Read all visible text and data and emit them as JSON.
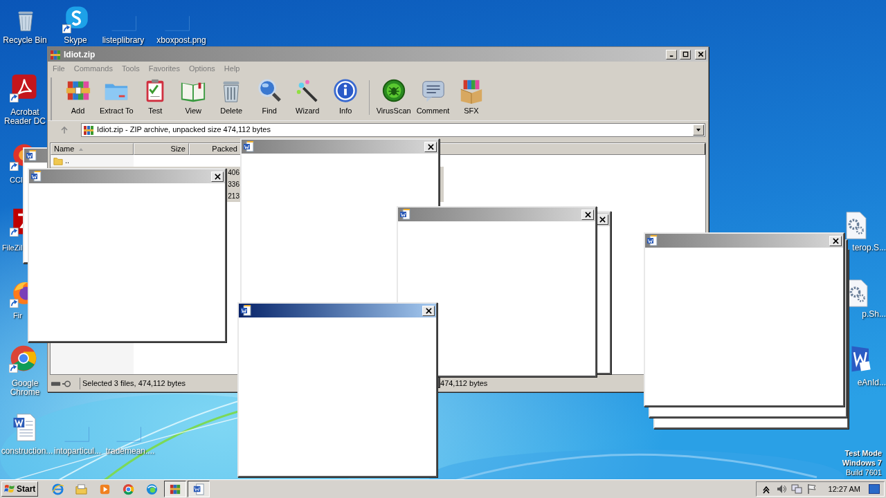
{
  "desktop_icons": [
    {
      "label": "Recycle Bin",
      "kind": "bin",
      "shortcut": false
    },
    {
      "label": "Skype",
      "kind": "skype",
      "shortcut": true
    },
    {
      "label": "listeplibrary",
      "kind": "blank",
      "shortcut": false
    },
    {
      "label": "xboxpost.png",
      "kind": "blank",
      "shortcut": false
    },
    {
      "label": "Acrobat Reader DC",
      "kind": "acrobat",
      "shortcut": true
    },
    {
      "label": "CCl",
      "kind": "ccleaner",
      "shortcut": true
    },
    {
      "label": "FileZil",
      "kind": "filezilla",
      "shortcut": true
    },
    {
      "label": "Fir",
      "kind": "firefox",
      "shortcut": true
    },
    {
      "label": "Google Chrome",
      "kind": "chrome",
      "shortcut": true
    },
    {
      "label": "construction...",
      "kind": "worddoc",
      "shortcut": false
    },
    {
      "label": "intoparticul...",
      "kind": "blank",
      "shortcut": false
    },
    {
      "label": "trademean....",
      "kind": "blank",
      "shortcut": false
    },
    {
      "label": "terop.S...",
      "kind": "gear",
      "shortcut": false
    },
    {
      "label": "p.Sh...",
      "kind": "gear",
      "shortcut": false
    },
    {
      "label": "eAnId...",
      "kind": "word",
      "shortcut": false
    }
  ],
  "winrar": {
    "title": "Idiot.zip",
    "active": false,
    "menu": [
      "File",
      "Commands",
      "Tools",
      "Favorites",
      "Options",
      "Help"
    ],
    "toolbar": [
      {
        "label": "Add",
        "kind": "add"
      },
      {
        "label": "Extract To",
        "kind": "extract"
      },
      {
        "label": "Test",
        "kind": "test"
      },
      {
        "label": "View",
        "kind": "view"
      },
      {
        "label": "Delete",
        "kind": "delete"
      },
      {
        "label": "Find",
        "kind": "find"
      },
      {
        "label": "Wizard",
        "kind": "wizard"
      },
      {
        "label": "Info",
        "kind": "info"
      },
      {
        "kind": "separator"
      },
      {
        "label": "VirusScan",
        "kind": "virus"
      },
      {
        "label": "Comment",
        "kind": "comment"
      },
      {
        "label": "SFX",
        "kind": "sfx"
      }
    ],
    "address": "Idiot.zip - ZIP archive, unpacked size 474,112 bytes",
    "columns": [
      "Name",
      "Size",
      "Packed"
    ],
    "rows": [
      {
        "name": "..",
        "kind": "folder",
        "selected": false
      },
      {
        "packed": "406",
        "selected": true
      },
      {
        "packed": "336",
        "selected": true
      },
      {
        "packed": "213",
        "selected": true
      }
    ],
    "status": "Selected 3 files, 474,112 bytes",
    "status_right": "474,112 bytes"
  },
  "popups": [
    {
      "kind": "dialog",
      "active": false
    },
    {
      "kind": "dialog",
      "active": false
    },
    {
      "kind": "dialog",
      "active": false
    },
    {
      "kind": "dialog",
      "active": false
    },
    {
      "kind": "dialog",
      "active": false
    },
    {
      "kind": "dialog",
      "active": true
    },
    {
      "kind": "dialog"
    },
    {
      "kind": "dialog"
    },
    {
      "kind": "dialog",
      "active": false
    }
  ],
  "taskbar": {
    "start": "Start",
    "apps": [
      {
        "kind": "ie",
        "pressed": false
      },
      {
        "kind": "explorer",
        "pressed": false
      },
      {
        "kind": "media",
        "pressed": false
      },
      {
        "kind": "chrome",
        "pressed": false
      },
      {
        "kind": "edge",
        "pressed": false
      },
      {
        "kind": "winrar",
        "pressed": true
      },
      {
        "kind": "word",
        "pressed": true
      }
    ],
    "clock": "12:27 AM"
  },
  "test_mode": [
    "Test Mode",
    "Windows 7",
    "Build 7601"
  ]
}
